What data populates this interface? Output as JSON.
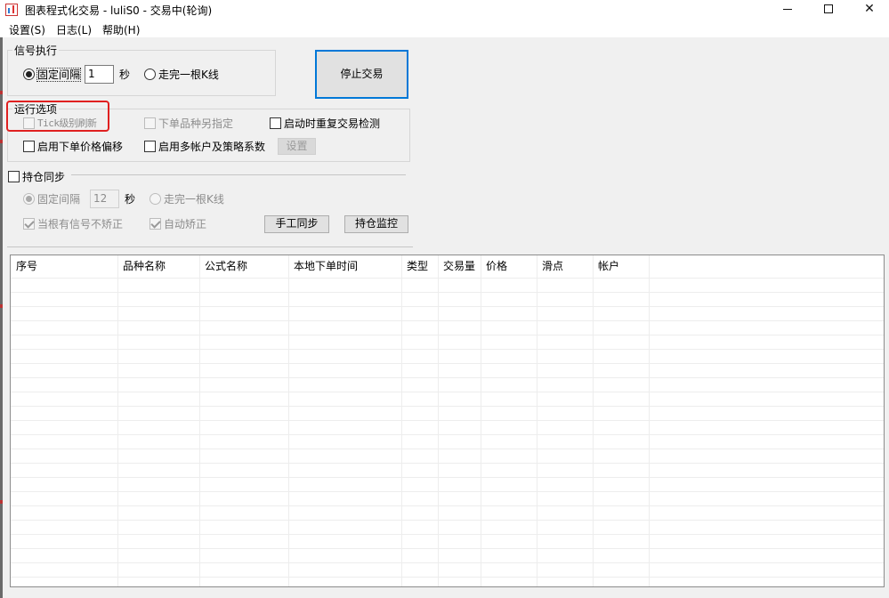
{
  "window": {
    "title": "图表程式化交易 - luliS0 - 交易中(轮询)",
    "controls": {
      "minimize": "minimize",
      "maximize": "maximize",
      "close": "✕"
    }
  },
  "menu": [
    "设置(S)",
    "日志(L)",
    "帮助(H)"
  ],
  "signal": {
    "legend": "信号执行",
    "fixed_interval_label": "固定间隔",
    "interval_value": "1",
    "unit": "秒",
    "kline_label": "走完一根K线"
  },
  "stop_button": "停止交易",
  "run_options": {
    "legend": "运行选项",
    "tick_refresh": "Tick级别刷新",
    "order_symbol": "下单品种另指定",
    "restart_check": "启动时重复交易检测",
    "price_offset": "启用下单价格偏移",
    "multi_account": "启用多帐户及策略系数",
    "settings_button": "设置"
  },
  "position_sync": {
    "label": "持仓同步",
    "fixed_interval_label": "固定间隔",
    "interval_value": "12",
    "unit": "秒",
    "kline_label": "走完一根K线",
    "no_correct": "当根有信号不矫正",
    "auto_correct": "自动矫正",
    "manual_sync_button": "手工同步",
    "monitor_button": "持仓监控"
  },
  "table": {
    "columns": [
      "序号",
      "品种名称",
      "公式名称",
      "本地下单时间",
      "类型",
      "交易量",
      "价格",
      "滑点",
      "帐户"
    ],
    "rows": []
  }
}
